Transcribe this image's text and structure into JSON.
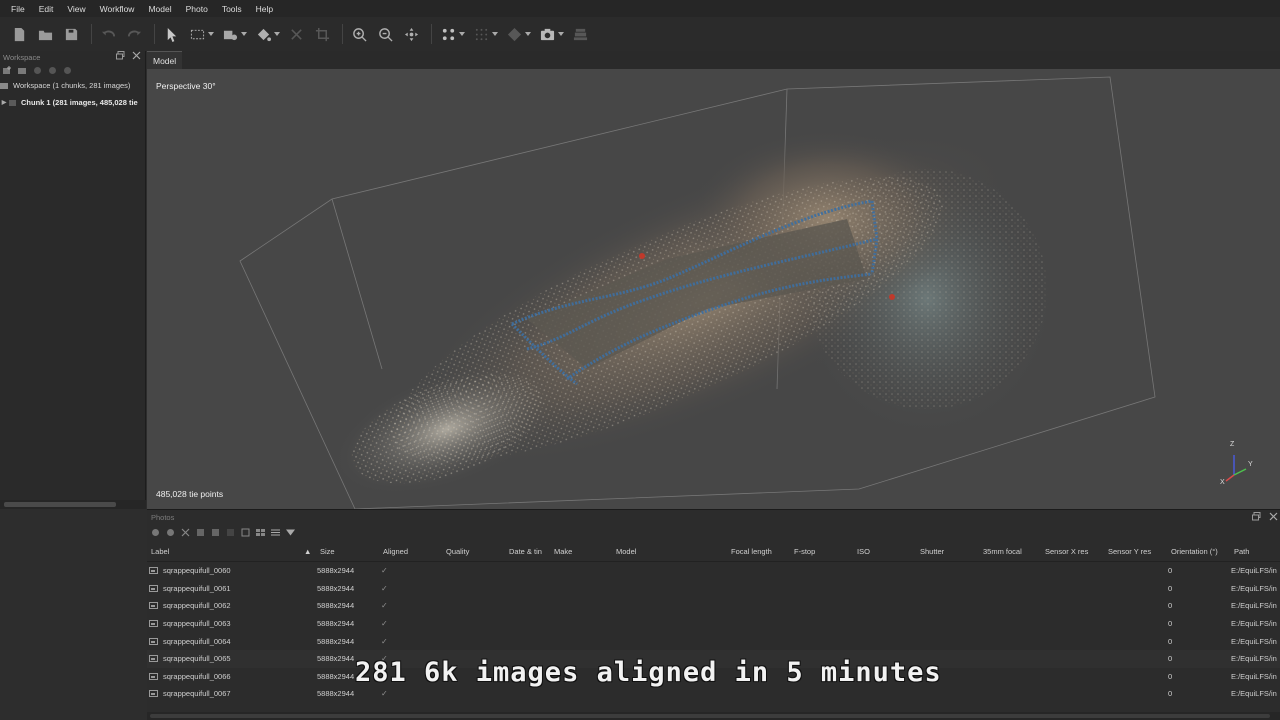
{
  "menu": [
    "File",
    "Edit",
    "View",
    "Workflow",
    "Model",
    "Photo",
    "Tools",
    "Help"
  ],
  "toolbar": {
    "icons": [
      "new-document-icon",
      "open-folder-icon",
      "save-icon",
      "undo-icon",
      "redo-icon",
      "select-arrow-icon",
      "rectangle-selection-icon",
      "shape-tool-icon",
      "fill-tool-icon",
      "delete-icon",
      "crop-icon",
      "zoom-in-icon",
      "zoom-out-icon",
      "move-icon",
      "points-view-icon",
      "dense-cloud-icon",
      "mesh-icon",
      "camera-icon",
      "layers-icon"
    ]
  },
  "workspace": {
    "title": "Workspace",
    "root": "Workspace (1 chunks, 281 images)",
    "chunk": "Chunk 1 (281 images, 485,028 tie"
  },
  "viewport": {
    "tab": "Model",
    "projection": "Perspective 30°",
    "tie_points": "485,028 tie points",
    "axes": {
      "z": "Z",
      "y": "Y",
      "x": "X"
    }
  },
  "photos": {
    "title": "Photos",
    "columns": [
      "Label",
      "Size",
      "Aligned",
      "Quality",
      "Date & tin",
      "Make",
      "Model",
      "Focal length",
      "F-stop",
      "ISO",
      "Shutter",
      "35mm focal",
      "Sensor X res",
      "Sensor Y res",
      "Orientation (°)",
      "Path"
    ],
    "rows": [
      {
        "label": "sqrappequifull_0060",
        "size": "5888x2944",
        "aligned": "✓",
        "orientation": "0",
        "path": "E:/EquiLFS/in"
      },
      {
        "label": "sqrappequifull_0061",
        "size": "5888x2944",
        "aligned": "✓",
        "orientation": "0",
        "path": "E:/EquiLFS/in"
      },
      {
        "label": "sqrappequifull_0062",
        "size": "5888x2944",
        "aligned": "✓",
        "orientation": "0",
        "path": "E:/EquiLFS/in"
      },
      {
        "label": "sqrappequifull_0063",
        "size": "5888x2944",
        "aligned": "✓",
        "orientation": "0",
        "path": "E:/EquiLFS/in"
      },
      {
        "label": "sqrappequifull_0064",
        "size": "5888x2944",
        "aligned": "✓",
        "orientation": "0",
        "path": "E:/EquiLFS/in"
      },
      {
        "label": "sqrappequifull_0065",
        "size": "5888x2944",
        "aligned": "✓",
        "orientation": "0",
        "path": "E:/EquiLFS/in"
      },
      {
        "label": "sqrappequifull_0066",
        "size": "5888x2944",
        "aligned": "✓",
        "orientation": "0",
        "path": "E:/EquiLFS/in"
      },
      {
        "label": "sqrappequifull_0067",
        "size": "5888x2944",
        "aligned": "✓",
        "orientation": "0",
        "path": "E:/EquiLFS/in"
      }
    ]
  },
  "caption": "281 6k images aligned in 5 minutes",
  "colors": {
    "viewport_bg": "#474747",
    "camera_track": "#3f6f9f",
    "panel_bg": "#2c2c2c"
  }
}
